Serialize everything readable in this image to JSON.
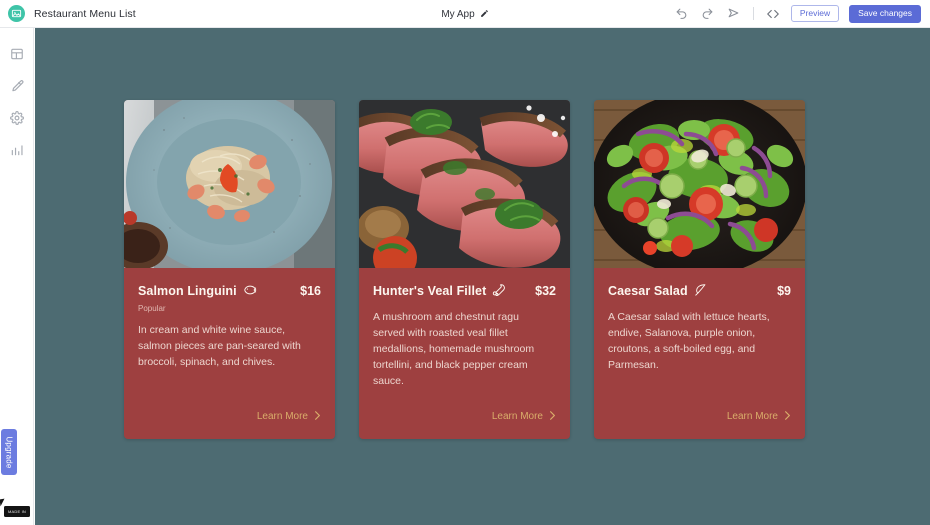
{
  "topbar": {
    "logo_icon": "image-logo-icon",
    "project_title": "Restaurant Menu List",
    "app_name": "My App",
    "edit_icon": "pencil-icon",
    "undo_icon": "undo-arrow-icon",
    "redo_icon": "redo-arrow-icon",
    "publish_icon": "send-arrow-icon",
    "code_icon": "code-brackets-icon",
    "preview_label": "Preview",
    "save_label": "Save changes",
    "accent_color": "#5b6bd6"
  },
  "sidebar": {
    "items": [
      {
        "icon": "layout-grid-icon",
        "name": "layout"
      },
      {
        "icon": "paintbrush-icon",
        "name": "design"
      },
      {
        "icon": "gear-icon",
        "name": "settings"
      },
      {
        "icon": "bar-chart-icon",
        "name": "analytics"
      }
    ],
    "upgrade_label": "Upgrade",
    "made_badge_label": "MADE IN",
    "upgrade_color": "#6c7ce0"
  },
  "canvas": {
    "background_color": "#4d6b72",
    "card_color": "#9e4040",
    "link_color": "#d9ad6a",
    "cards": [
      {
        "name": "Salmon Linguini",
        "icon": "fish-icon",
        "price": "$16",
        "tag": "Popular",
        "description": "In cream and white wine sauce, salmon pieces are pan-seared with broccoli, spinach, and chives.",
        "link_label": "Learn More",
        "image_alt": "pasta-on-blue-plate"
      },
      {
        "name": "Hunter's Veal Fillet",
        "icon": "meat-drumstick-icon",
        "price": "$32",
        "tag": "",
        "description": "A mushroom and chestnut ragu served with roasted veal fillet medallions, homemade mushroom tortellini, and black pepper cream sauce.",
        "link_label": "Learn More",
        "image_alt": "sliced-steak-with-herbs"
      },
      {
        "name": "Caesar Salad",
        "icon": "leaf-icon",
        "price": "$9",
        "tag": "",
        "description": "A Caesar salad with lettuce hearts, endive, Salanova, purple onion, croutons, a soft-boiled egg, and Parmesan.",
        "link_label": "Learn More",
        "image_alt": "green-salad-in-dark-bowl"
      }
    ]
  }
}
